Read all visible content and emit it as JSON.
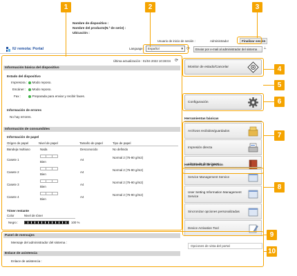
{
  "header": {
    "device_name_label": "Nombre de dispositivo :",
    "product_name_label": "Nombre del producto(N.º de serie) :",
    "location_label": "Ubicación :",
    "login_user_label": "Usuario de inicio de sesión :",
    "login_user": "Administrador",
    "logout_button": "Finalizar sesión",
    "app_title": "IU remota: Portal",
    "language_label": "Language :",
    "language_value": "Español",
    "email_admin_button": "Enviar por e-mail al administrador del sistema"
  },
  "device_info": {
    "section_title": "Información básica del dispositivo",
    "last_update": "Última actualización : 01/04 2022 10:38:04",
    "status_title": "Estado del dispositivo",
    "printer_label": "Impresora :",
    "printer_status": "Modo reposo.",
    "scanner_label": "Escáner :",
    "scanner_status": "Modo reposo.",
    "fax_label": "Fax :",
    "fax_status": "Preparada para enviar y recibir faxes.",
    "errors_title": "Información de errores",
    "errors_value": "No hay errores."
  },
  "consumables": {
    "section_title": "Información de consumibles",
    "paper_title": "Información de papel",
    "columns": [
      "Origen de papel",
      "Nivel de papel",
      "Tamaño de papel",
      "Tipo de papel"
    ],
    "rows": [
      {
        "source": "Bandeja multiuso",
        "level": "Nada",
        "size": "Desconocido",
        "type": "No definido"
      },
      {
        "source": "Casete 1",
        "level": "Bien",
        "size": "A4",
        "type": "Normal 2 (76-90 g/m2)"
      },
      {
        "source": "Casete 2",
        "level": "Bien",
        "size": "A4",
        "type": "Normal 2 (76-90 g/m2)"
      },
      {
        "source": "Casete 3",
        "level": "Bien",
        "size": "A4",
        "type": "Normal 2 (76-90 g/m2)"
      },
      {
        "source": "Casete 4",
        "level": "Bien",
        "size": "A4",
        "type": "Normal 2 (76-90 g/m2)"
      }
    ],
    "toner_title": "Tóner restante",
    "toner_columns": [
      "Color",
      "Nivel de tóner"
    ],
    "toner_color": "Negro :",
    "toner_level": "100 %",
    "toner_fraction": 1.0
  },
  "messages": {
    "panel_title": "Panel de mensajes",
    "admin_message_label": "Mensaje del administrador del sistema :",
    "support_title": "Enlace de asistencia",
    "support_label": "Enlace de asistencia :"
  },
  "right_menu": {
    "status_monitor": "Monitor de estado/Cancelar",
    "settings": "Configuración",
    "basic_tools_title": "Herramientas básicas",
    "basic_tools": [
      "Archivos recibidos/guardados",
      "Impresión directa",
      "Libreta de direcciones"
    ],
    "mgmt_tools_title": "Herramientas de gestión",
    "mgmt_tools": [
      "Service Management Service",
      "User Setting Information Management Service",
      "Sincronizar opciones personalizadas",
      "Device Activation Tool"
    ],
    "portal_options": "Opciones de vista del portal"
  },
  "callouts": [
    "1",
    "2",
    "3",
    "4",
    "5",
    "6",
    "7",
    "8",
    "9",
    "10"
  ],
  "colors": {
    "callout": "#f5a400",
    "status_ok": "#3cb043",
    "section_head": "#d6d6d6",
    "brand_blue": "#1e4fa0"
  }
}
